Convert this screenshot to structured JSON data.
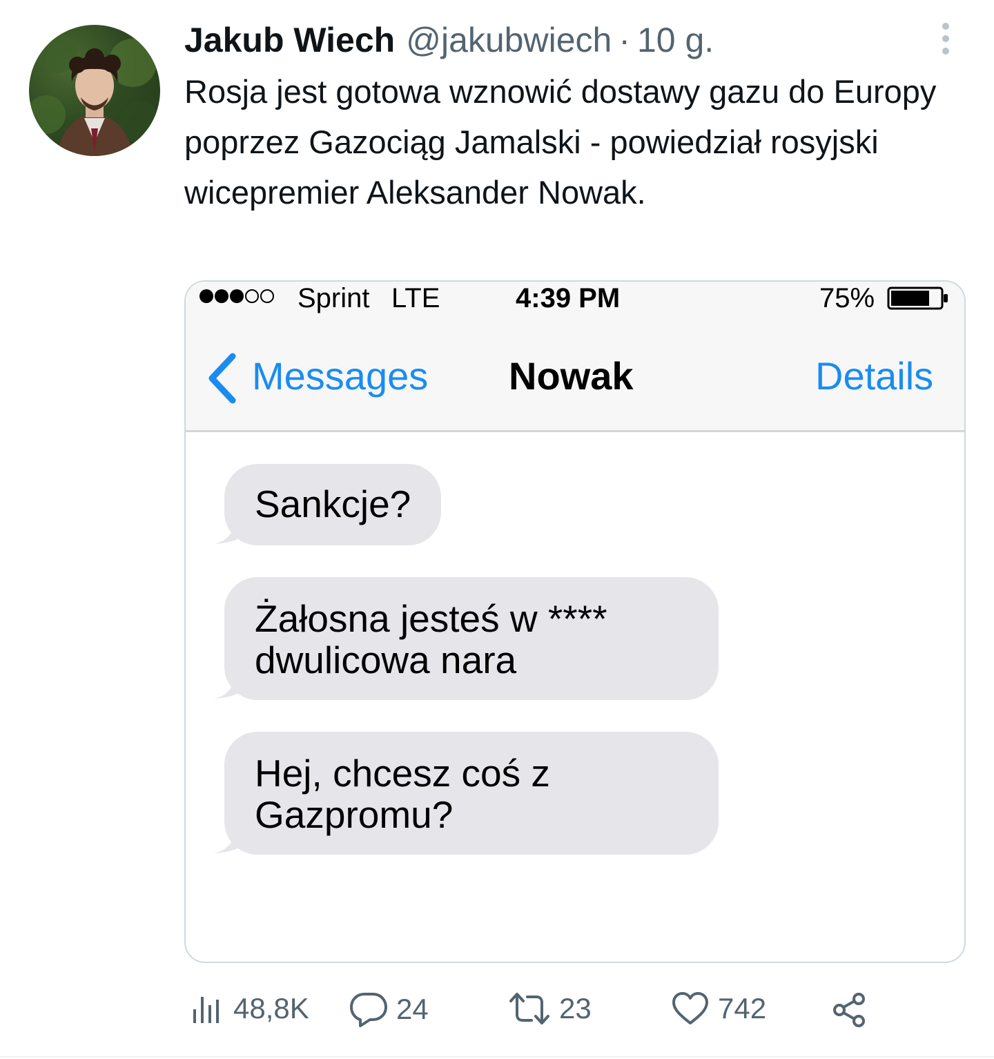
{
  "tweet": {
    "author_name": "Jakub Wiech",
    "author_handle": "@jakubwiech",
    "separator": "·",
    "time_ago": "10 g.",
    "text": "Rosja jest gotowa wznowić dostawy gazu do Europy poprzez Gazociąg Jamalski - powiedział rosyjski wicepremier Aleksander Nowak."
  },
  "phone": {
    "status_bar": {
      "carrier": "Sprint",
      "network": "LTE",
      "time": "4:39 PM",
      "battery_percent": "75%",
      "signal_bars_filled": 3,
      "signal_bars_total": 5,
      "battery_level": 0.75
    },
    "nav": {
      "back_label": "Messages",
      "title": "Nowak",
      "details_label": "Details"
    },
    "messages": [
      "Sankcje?",
      "Żałosna jesteś w ****\ndwulicowa nara",
      "Hej, chcesz coś z\nGazpromu?"
    ]
  },
  "actions": {
    "views": "48,8K",
    "replies": "24",
    "retweets": "23",
    "likes": "742"
  },
  "colors": {
    "ios_blue": "#1a8cf0",
    "bubble_gray": "#e5e5ea",
    "muted_text": "#536471"
  },
  "icons": {
    "more": "more-vertical-icon",
    "back": "chevron-left-icon",
    "views": "bar-chart-icon",
    "reply": "speech-bubble-icon",
    "retweet": "retweet-icon",
    "like": "heart-icon",
    "share": "share-icon"
  }
}
